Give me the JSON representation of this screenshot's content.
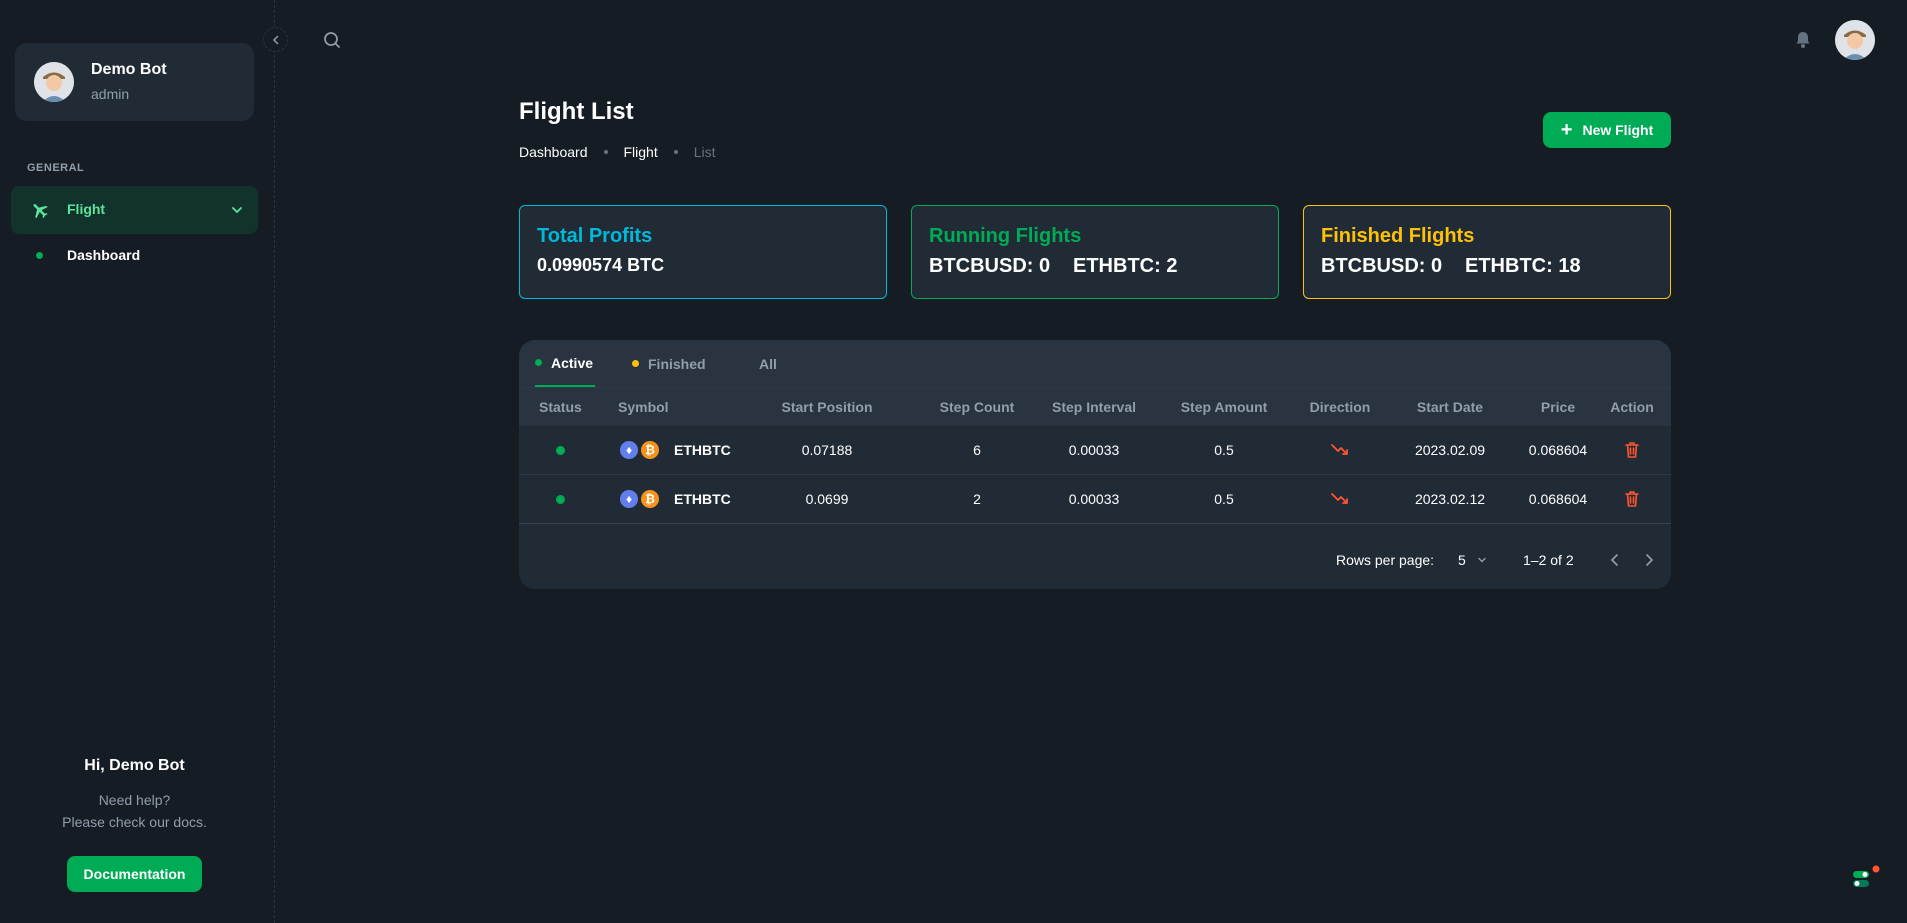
{
  "user": {
    "name": "Demo Bot",
    "role": "admin"
  },
  "nav": {
    "section": "GENERAL",
    "flight_label": "Flight",
    "dashboard_label": "Dashboard"
  },
  "help": {
    "title": "Hi, Demo Bot",
    "line1": "Need help?",
    "line2": "Please check our docs.",
    "button": "Documentation"
  },
  "header": {
    "title": "Flight List",
    "breadcrumb": [
      "Dashboard",
      "Flight",
      "List"
    ],
    "new_button": "New Flight"
  },
  "stats": {
    "profits": {
      "title": "Total Profits",
      "value": "0.0990574 BTC"
    },
    "running": {
      "title": "Running Flights",
      "a": "BTCBUSD: 0",
      "b": "ETHBTC: 2"
    },
    "finished": {
      "title": "Finished Flights",
      "a": "BTCBUSD: 0",
      "b": "ETHBTC: 18"
    }
  },
  "tabs": [
    {
      "label": "Active",
      "dot": "#00ab55"
    },
    {
      "label": "Finished",
      "dot": "#ffc107"
    },
    {
      "label": "All"
    }
  ],
  "columns": [
    "Status",
    "Symbol",
    "Start Position",
    "Step Count",
    "Step Interval",
    "Step Amount",
    "Direction",
    "Start Date",
    "Price",
    "Action"
  ],
  "rows": [
    {
      "symbol": "ETHBTC",
      "start_position": "0.07188",
      "step_count": "6",
      "step_interval": "0.00033",
      "step_amount": "0.5",
      "direction": "trending-down-icon",
      "start_date": "2023.02.09",
      "price": "0.068604"
    },
    {
      "symbol": "ETHBTC",
      "start_position": "0.0699",
      "step_count": "2",
      "step_interval": "0.00033",
      "step_amount": "0.5",
      "direction": "trending-down-icon",
      "start_date": "2023.02.12",
      "price": "0.068604"
    }
  ],
  "pagination": {
    "rows_label": "Rows per page:",
    "rows_value": "5",
    "range": "1–2 of 2"
  },
  "colors": {
    "accent": "#00ab55",
    "info": "#00b8d9",
    "warning": "#ffc107",
    "danger": "#ff5630",
    "background": "#161c24",
    "card": "#212b36"
  }
}
